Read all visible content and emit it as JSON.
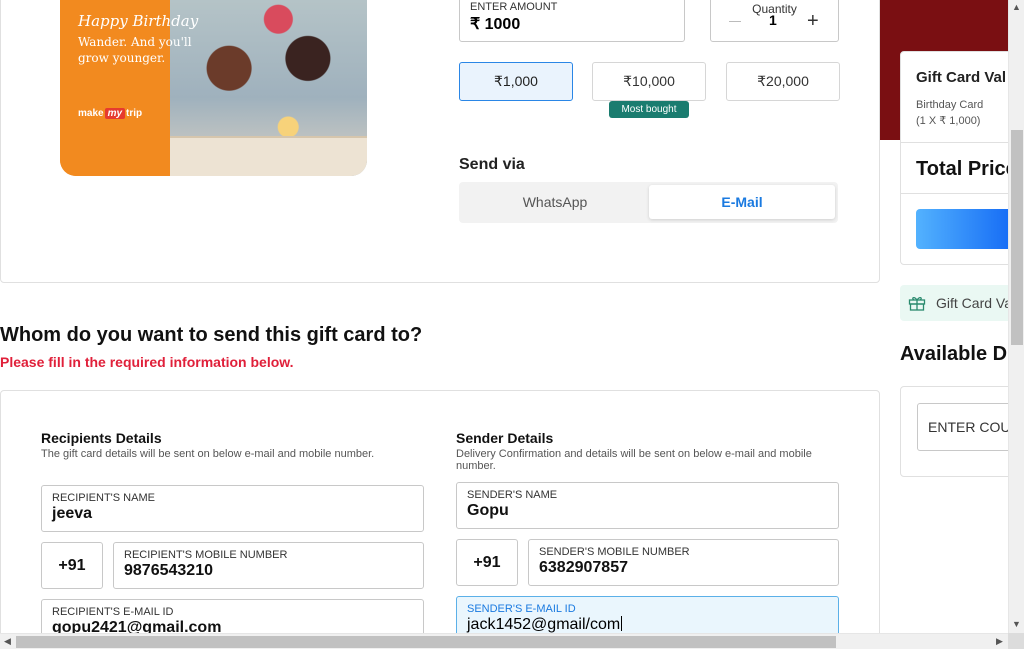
{
  "gift_card": {
    "greeting": "Happy Birthday",
    "tagline": "Wander. And you'll grow younger.",
    "brand_pre": "make",
    "brand_my": "my",
    "brand_post": "trip"
  },
  "amount": {
    "label": "ENTER AMOUNT",
    "value": "₹ 1000"
  },
  "quantity": {
    "label": "Quantity",
    "value": "1",
    "minus": "−",
    "plus": "+"
  },
  "denominations": [
    {
      "label": "₹1,000",
      "selected": true
    },
    {
      "label": "₹10,000",
      "selected": false
    },
    {
      "label": "₹20,000",
      "selected": false
    }
  ],
  "most_bought": "Most bought",
  "send_via": {
    "title": "Send via",
    "options": [
      "WhatsApp",
      "E-Mail"
    ],
    "selected": "E-Mail"
  },
  "recipient_section": {
    "title": "Whom do you want to send this gift card to?",
    "subtitle": "Please fill in the required information below."
  },
  "recipient": {
    "heading": "Recipients Details",
    "description": "The gift card details will be sent on below e-mail and mobile number.",
    "name_label": "RECIPIENT'S NAME",
    "name_value": "jeeva",
    "country_code": "+91",
    "mobile_label": "RECIPIENT'S MOBILE NUMBER",
    "mobile_value": "9876543210",
    "email_label": "RECIPIENT'S E-MAIL ID",
    "email_value": "gopu2421@gmail.com"
  },
  "sender": {
    "heading": "Sender Details",
    "description": "Delivery Confirmation and details will be sent on below e-mail and mobile number.",
    "name_label": "SENDER'S NAME",
    "name_value": "Gopu",
    "country_code": "+91",
    "mobile_label": "SENDER'S MOBILE NUMBER",
    "mobile_value": "6382907857",
    "email_label": "SENDER'S E-MAIL ID",
    "email_value": "jack1452@gmail/com"
  },
  "price_panel": {
    "title": "Gift Card Val",
    "item_line1": "Birthday Card",
    "item_line2": "(1 X ₹ 1,000)",
    "total_label": "Total Price"
  },
  "gift_card_value_strip": "Gift Card Va",
  "available_title": "Available Di",
  "coupon_placeholder": "ENTER COUP",
  "colors": {
    "accent_blue": "#1a7ae0",
    "alert_red": "#e0203a",
    "badge_teal": "#1a7c6f",
    "brand_orange": "#f28a1f",
    "maroon": "#7a0f12"
  }
}
